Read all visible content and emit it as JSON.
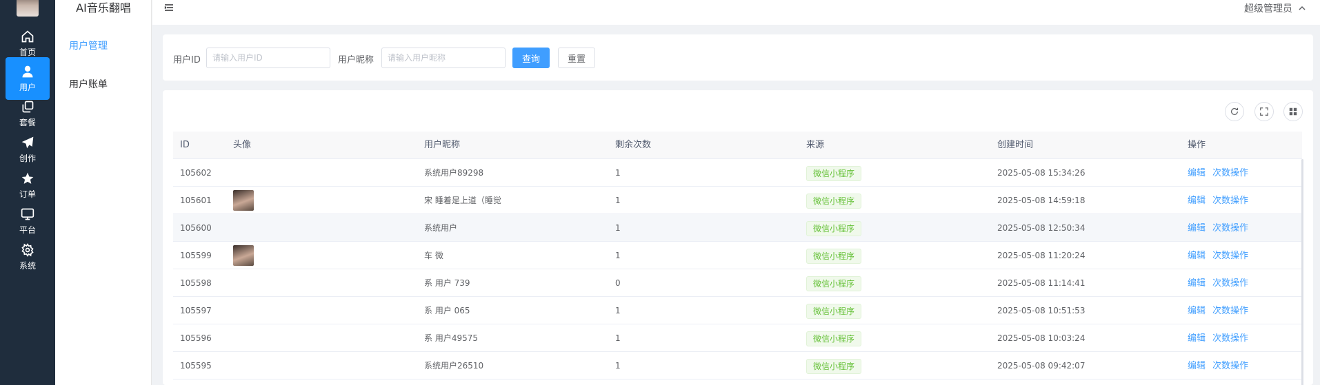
{
  "app": {
    "title": "AI音乐翻唱"
  },
  "rail": {
    "items": [
      {
        "label": "首页",
        "icon": "home-icon"
      },
      {
        "label": "用户",
        "icon": "user-icon",
        "active": true
      },
      {
        "label": "套餐",
        "icon": "copy-icon"
      },
      {
        "label": "创作",
        "icon": "send-icon"
      },
      {
        "label": "订单",
        "icon": "star-icon"
      },
      {
        "label": "平台",
        "icon": "monitor-icon"
      },
      {
        "label": "系统",
        "icon": "gear-icon"
      }
    ]
  },
  "submenu": {
    "items": [
      {
        "label": "用户管理",
        "active": true
      },
      {
        "label": "用户账单"
      }
    ]
  },
  "topbar": {
    "user": "超级管理员"
  },
  "search": {
    "uid_label": "用户ID",
    "uid_placeholder": "请输入用户ID",
    "nick_label": "用户昵称",
    "nick_placeholder": "请输入用户昵称",
    "query_label": "查询",
    "reset_label": "重置"
  },
  "table": {
    "columns": [
      "ID",
      "头像",
      "用户昵称",
      "剩余次数",
      "来源",
      "创建时间",
      "操作"
    ],
    "rows": [
      {
        "id": "105602",
        "avatar": false,
        "nick": "系统用户89298",
        "count": "1",
        "source": "微信小程序",
        "time": "2025-05-08 15:34:26"
      },
      {
        "id": "105601",
        "avatar": true,
        "nick": "宋      睡着是上道（睡觉",
        "count": "1",
        "source": "微信小程序",
        "time": "2025-05-08 14:59:18"
      },
      {
        "id": "105600",
        "avatar": false,
        "nick": "系统用户",
        "count": "1",
        "source": "微信小程序",
        "time": "2025-05-08 12:50:34"
      },
      {
        "id": "105599",
        "avatar": true,
        "nick": "车  微",
        "count": "1",
        "source": "微信小程序",
        "time": "2025-05-08 11:20:24"
      },
      {
        "id": "105598",
        "avatar": false,
        "nick": "系  用户  739",
        "count": "0",
        "source": "微信小程序",
        "time": "2025-05-08 11:14:41"
      },
      {
        "id": "105597",
        "avatar": false,
        "nick": "系  用户  065",
        "count": "1",
        "source": "微信小程序",
        "time": "2025-05-08 10:51:53"
      },
      {
        "id": "105596",
        "avatar": false,
        "nick": "系  用户49575",
        "count": "1",
        "source": "微信小程序",
        "time": "2025-05-08 10:03:24"
      },
      {
        "id": "105595",
        "avatar": false,
        "nick": "系统用户26510",
        "count": "1",
        "source": "微信小程序",
        "time": "2025-05-08 09:42:07"
      }
    ],
    "ops": {
      "edit": "编辑",
      "count_op": "次数操作"
    }
  },
  "colors": {
    "primary": "#409eff",
    "rail_bg": "#1f2d3d",
    "rail_active": "#1890ff",
    "tag_green": "#67c23a"
  }
}
